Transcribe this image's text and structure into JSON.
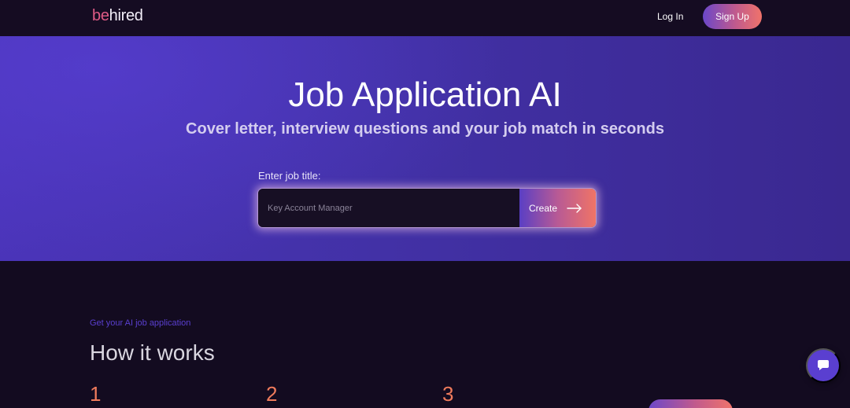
{
  "header": {
    "logo_part1": "be",
    "logo_part2": "hired",
    "login_label": "Log In",
    "signup_label": "Sign Up"
  },
  "hero": {
    "title": "Job Application AI",
    "subtitle": "Cover letter, interview questions and your job match in seconds",
    "input_label": "Enter job title:",
    "input_placeholder": "Key Account Manager",
    "input_value": "",
    "create_label": "Create",
    "create_icon": "arrow-right-icon"
  },
  "how_it_works": {
    "eyebrow": "Get your AI job application",
    "title": "How it works",
    "steps": [
      {
        "number": "1"
      },
      {
        "number": "2"
      },
      {
        "number": "3"
      }
    ]
  },
  "chat": {
    "icon": "chat-bubble-icon"
  },
  "colors": {
    "page_background": "#130b20",
    "hero_purple": "#4a34b8",
    "accent_coral": "#ef7b5c",
    "accent_pink": "#e05b86",
    "eyebrow_purple": "#5a3fd0"
  }
}
